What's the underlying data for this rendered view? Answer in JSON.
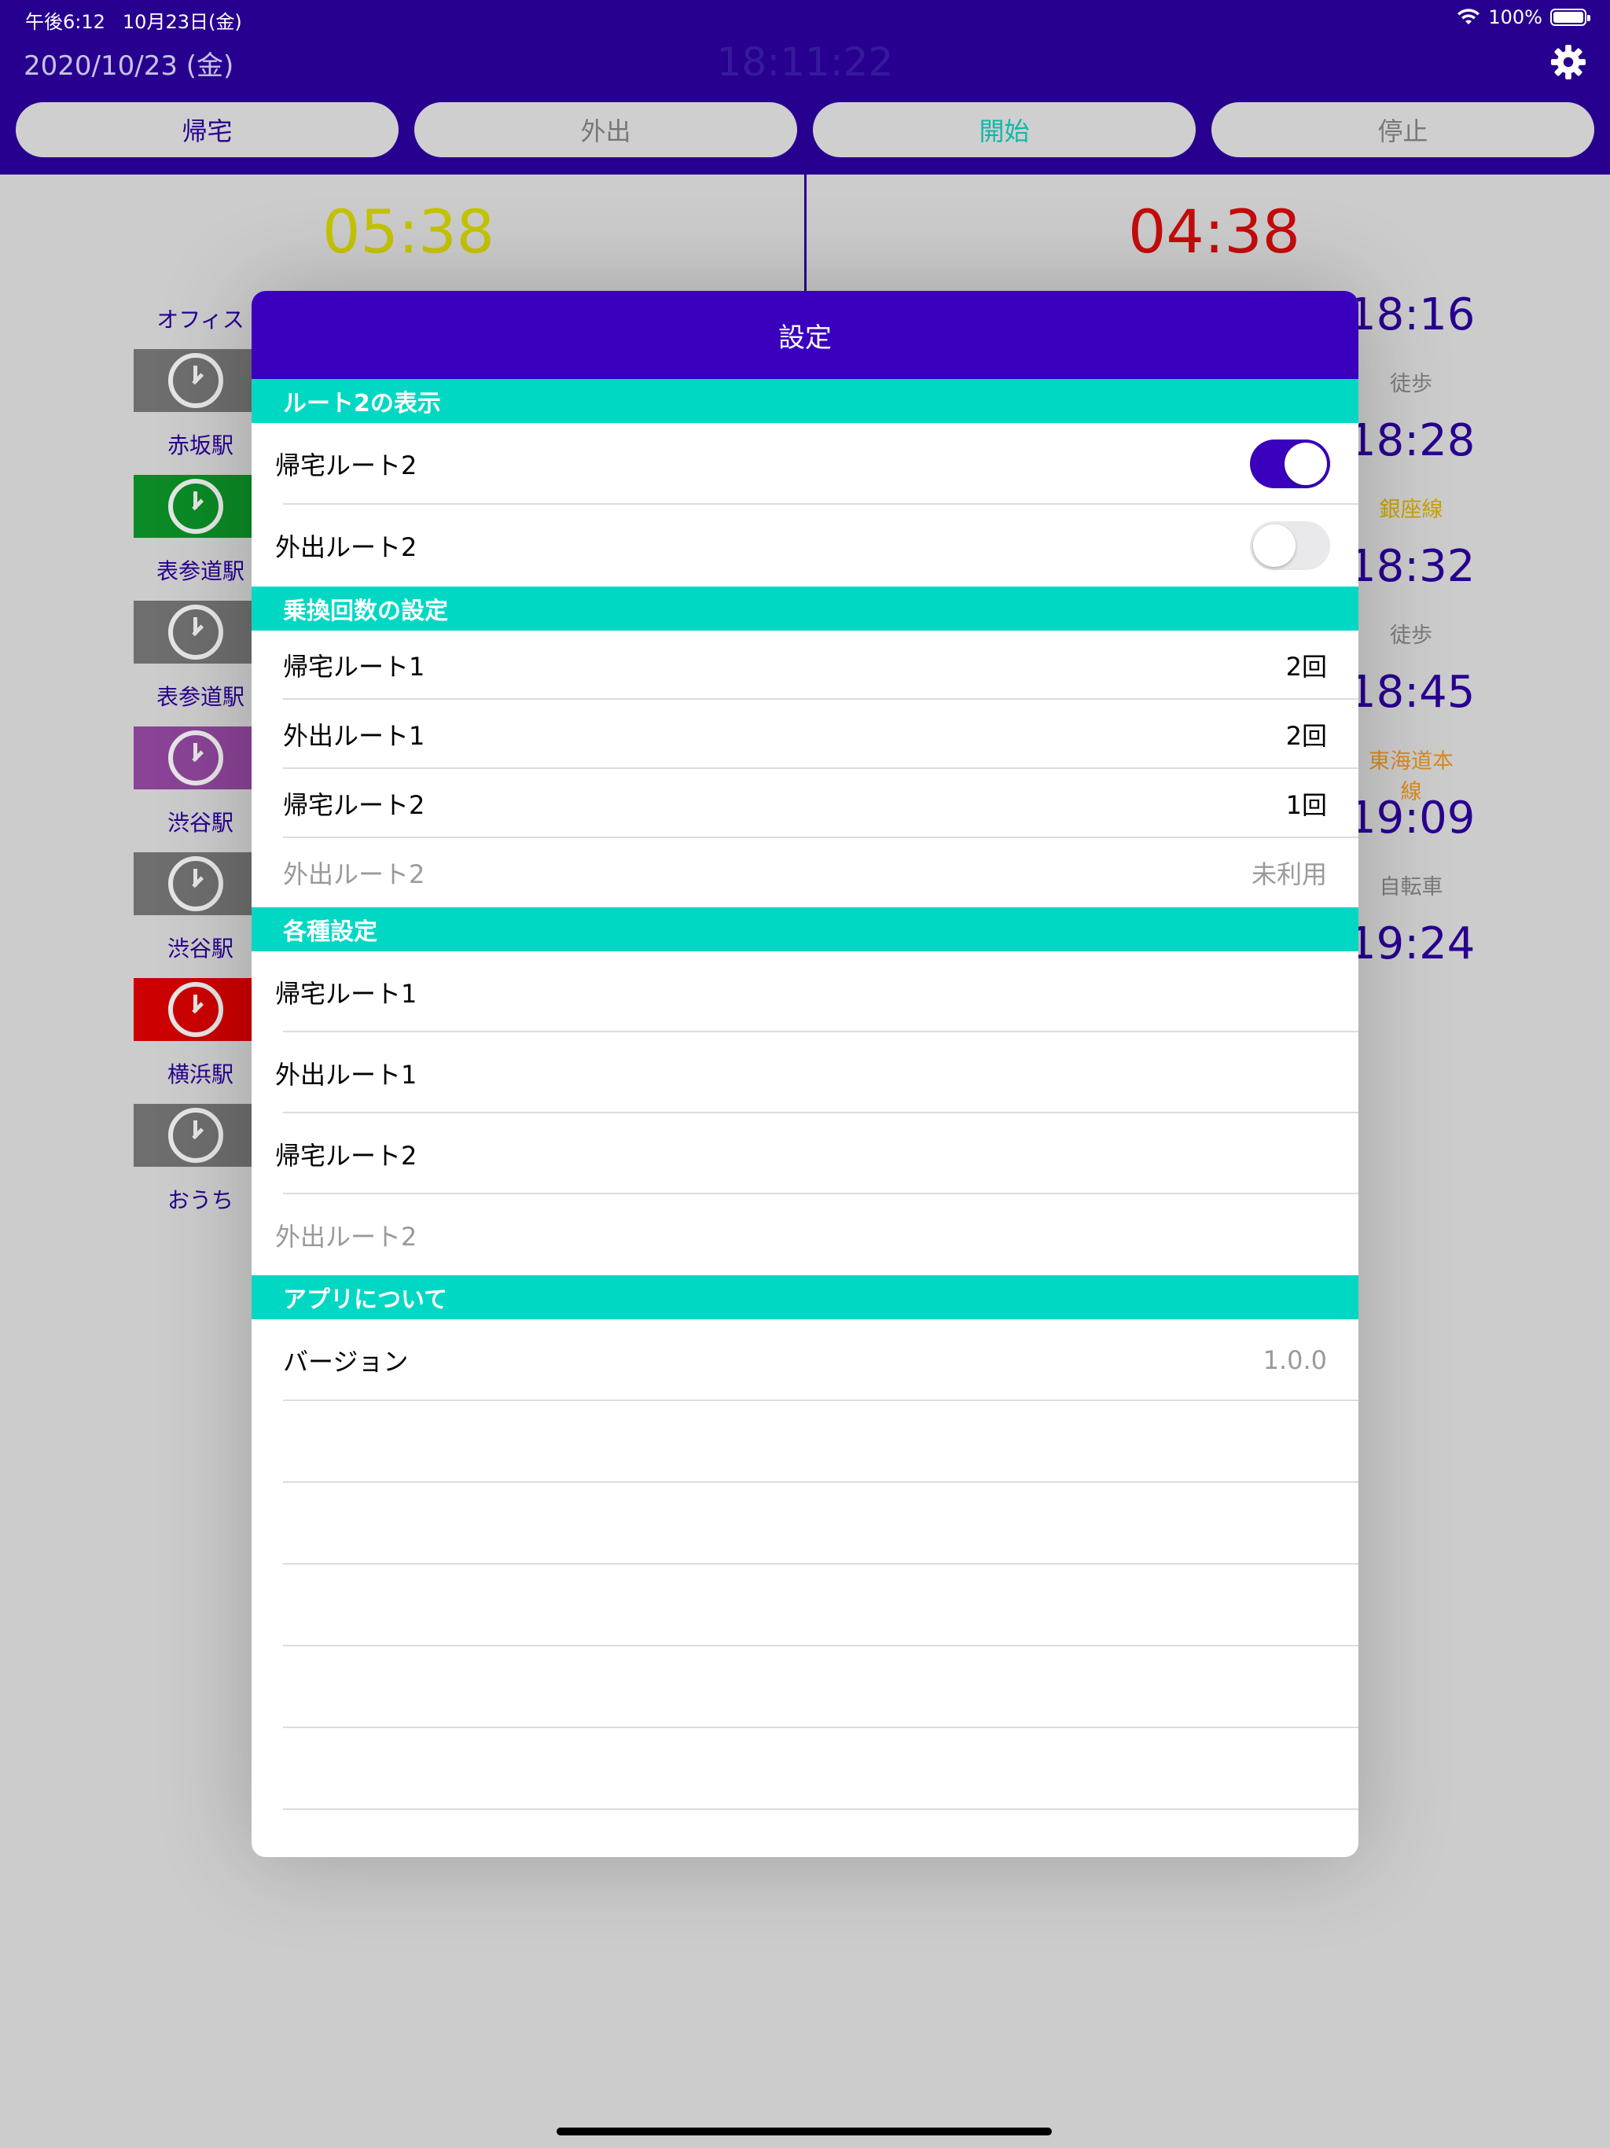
{
  "status_bar": {
    "time": "午後6:12",
    "date": "10月23日(金)",
    "battery": "100%"
  },
  "header": {
    "date": "2020/10/23 (金)",
    "clock": "18:11:22",
    "buttons": [
      {
        "label": "帰宅",
        "color": "#28008f"
      },
      {
        "label": "外出",
        "color": "#777777"
      },
      {
        "label": "開始",
        "color": "#0fb8a8"
      },
      {
        "label": "停止",
        "color": "#777777"
      }
    ]
  },
  "timers": {
    "left": "05:38",
    "right": "04:38"
  },
  "route": {
    "stops": [
      "オフィス",
      "赤坂駅",
      "表参道駅",
      "表参道駅",
      "渋谷駅",
      "渋谷駅",
      "横浜駅",
      "おうち"
    ],
    "segments": [
      {
        "color": "#6e6e6e"
      },
      {
        "color": "#0b8a25"
      },
      {
        "color": "#6e6e6e"
      },
      {
        "color": "#8a4396"
      },
      {
        "color": "#6e6e6e"
      },
      {
        "color": "#cc0000"
      },
      {
        "color": "#6e6e6e"
      }
    ],
    "times": [
      "18:16",
      "18:28",
      "18:32",
      "18:45",
      "19:09",
      "19:24"
    ],
    "modes": [
      {
        "label": "徒歩",
        "color": "#7a7a7a"
      },
      {
        "label": "銀座線",
        "color": "#c9a000"
      },
      {
        "label": "徒歩",
        "color": "#7a7a7a"
      },
      {
        "label": "東海道本線",
        "color": "#d88a1e"
      },
      {
        "label": "自転車",
        "color": "#7a7a7a"
      }
    ]
  },
  "modal": {
    "title": "設定",
    "sections": {
      "route2_display": {
        "header": "ルート2の表示",
        "rows": [
          {
            "label": "帰宅ルート2",
            "on": true
          },
          {
            "label": "外出ルート2",
            "on": false
          }
        ]
      },
      "transfers": {
        "header": "乗換回数の設定",
        "rows": [
          {
            "label": "帰宅ルート1",
            "value": "2回"
          },
          {
            "label": "外出ルート1",
            "value": "2回"
          },
          {
            "label": "帰宅ルート2",
            "value": "1回"
          },
          {
            "label": "外出ルート2",
            "value": "未利用"
          }
        ]
      },
      "settings": {
        "header": "各種設定",
        "rows": [
          {
            "label": "帰宅ルート1"
          },
          {
            "label": "外出ルート1"
          },
          {
            "label": "帰宅ルート2"
          },
          {
            "label": "外出ルート2"
          }
        ]
      },
      "about": {
        "header": "アプリについて",
        "rows": [
          {
            "label": "バージョン",
            "value": "1.0.0"
          }
        ]
      }
    }
  }
}
